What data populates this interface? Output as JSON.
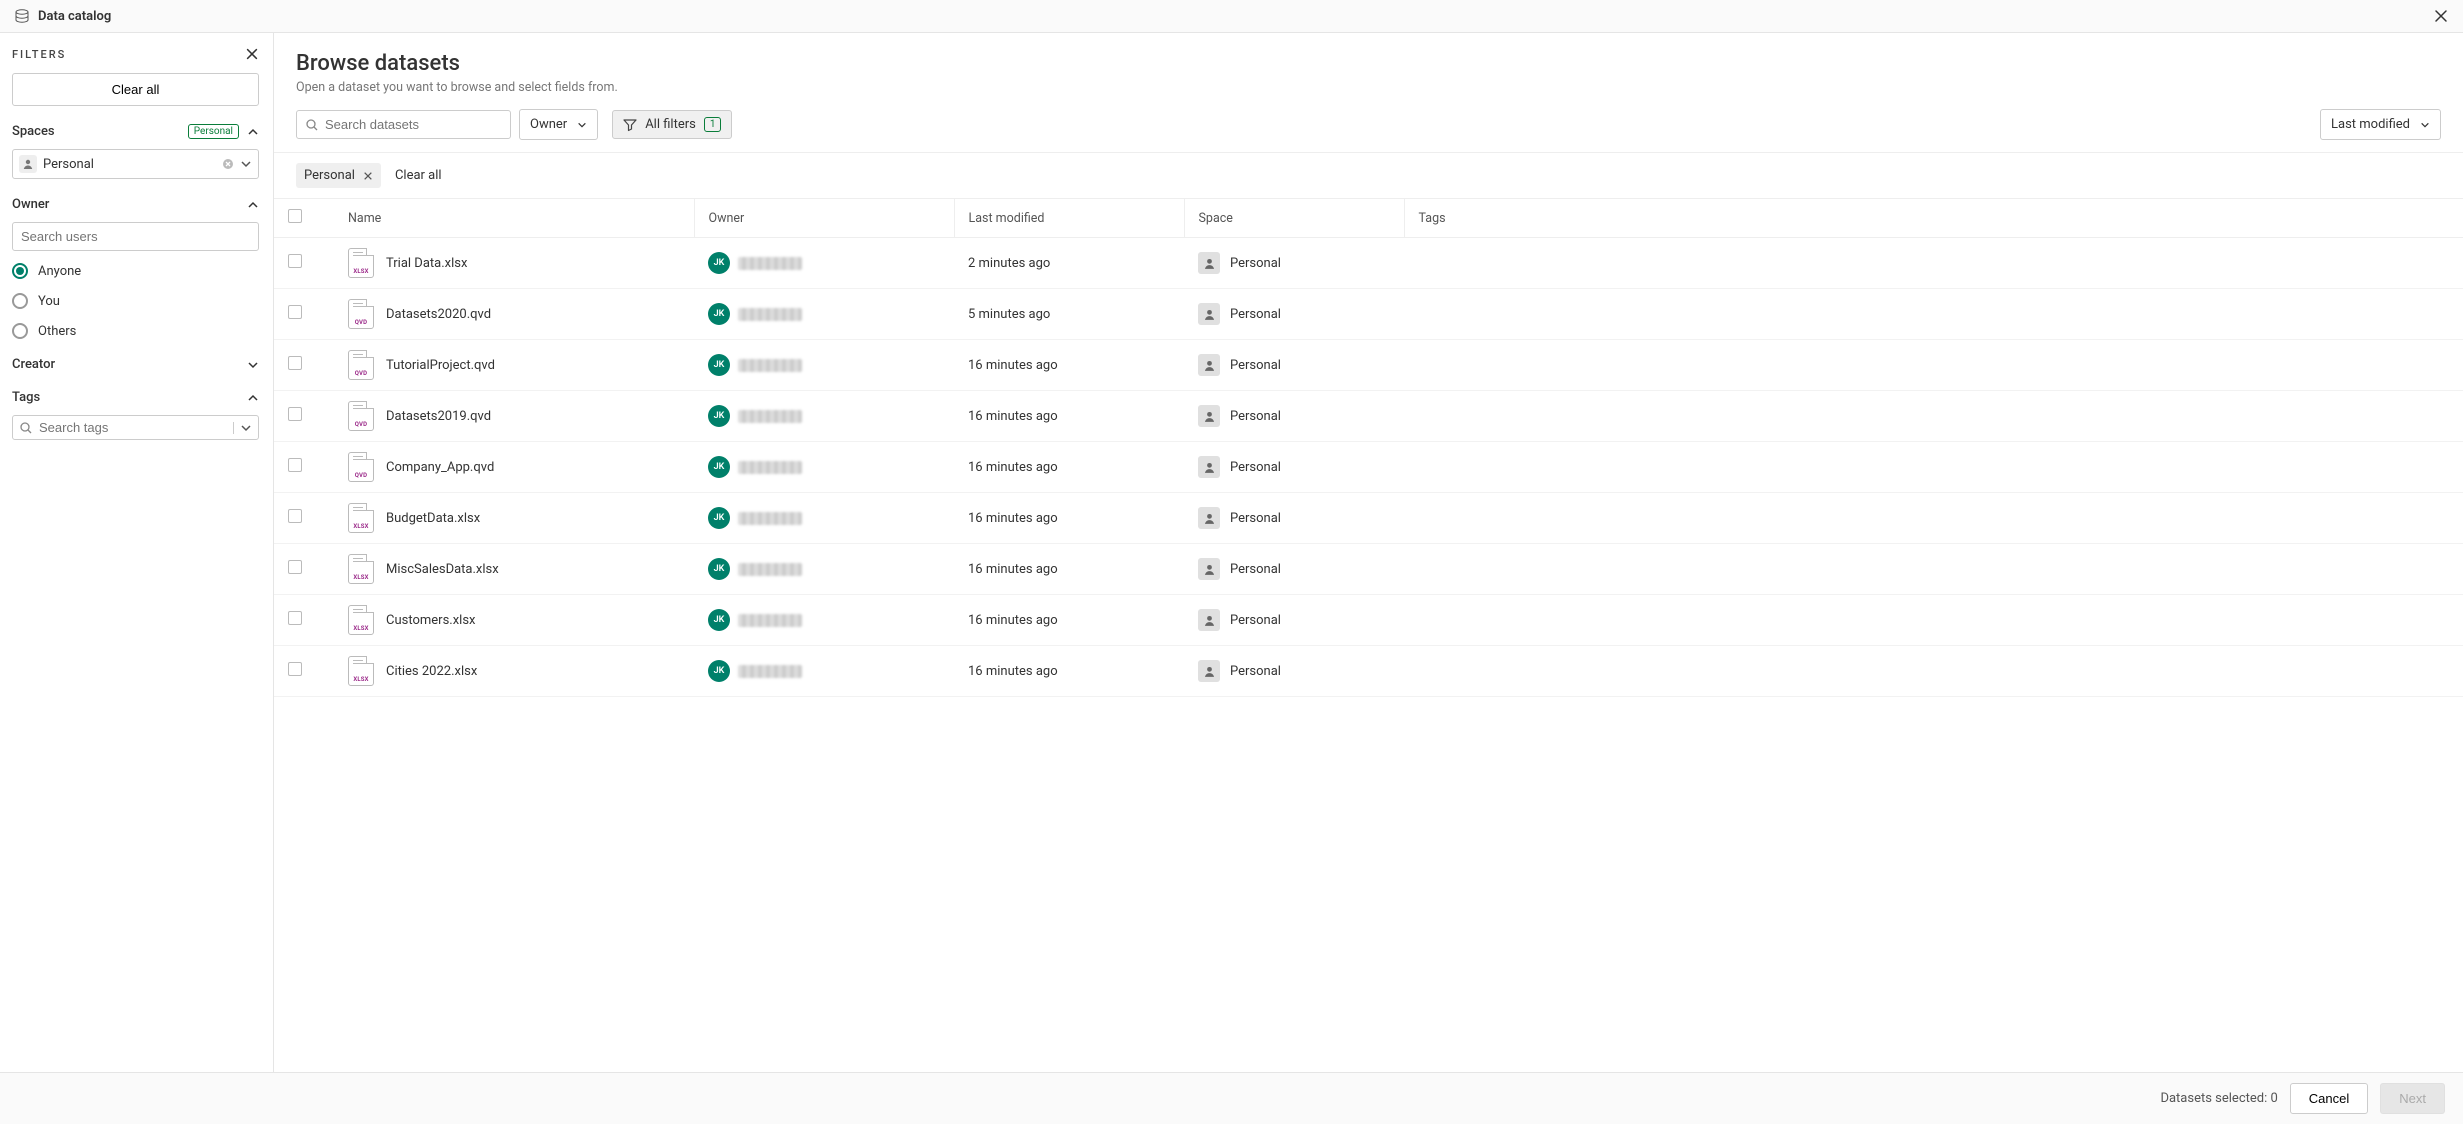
{
  "topbar": {
    "title": "Data catalog"
  },
  "sidebar": {
    "header": "FILTERS",
    "clear_all": "Clear all",
    "spaces": {
      "title": "Spaces",
      "badge": "Personal",
      "selected": "Personal"
    },
    "owner": {
      "title": "Owner",
      "search_placeholder": "Search users",
      "options": {
        "anyone": "Anyone",
        "you": "You",
        "others": "Others"
      }
    },
    "creator": {
      "title": "Creator"
    },
    "tags": {
      "title": "Tags",
      "search_placeholder": "Search tags"
    }
  },
  "main": {
    "title": "Browse datasets",
    "subtitle": "Open a dataset you want to browse and select fields from.",
    "search_placeholder": "Search datasets",
    "owner_dropdown": "Owner",
    "all_filters": "All filters",
    "all_filters_count": "1",
    "sort": "Last modified",
    "chip": "Personal",
    "chips_clear": "Clear all",
    "columns": {
      "name": "Name",
      "owner": "Owner",
      "modified": "Last modified",
      "space": "Space",
      "tags": "Tags"
    },
    "owner_initials": "JK",
    "rows": [
      {
        "name": "Trial Data.xlsx",
        "ext": "XLSX",
        "modified": "2 minutes ago",
        "space": "Personal"
      },
      {
        "name": "Datasets2020.qvd",
        "ext": "QVD",
        "modified": "5 minutes ago",
        "space": "Personal"
      },
      {
        "name": "TutorialProject.qvd",
        "ext": "QVD",
        "modified": "16 minutes ago",
        "space": "Personal"
      },
      {
        "name": "Datasets2019.qvd",
        "ext": "QVD",
        "modified": "16 minutes ago",
        "space": "Personal"
      },
      {
        "name": "Company_App.qvd",
        "ext": "QVD",
        "modified": "16 minutes ago",
        "space": "Personal"
      },
      {
        "name": "BudgetData.xlsx",
        "ext": "XLSX",
        "modified": "16 minutes ago",
        "space": "Personal"
      },
      {
        "name": "MiscSalesData.xlsx",
        "ext": "XLSX",
        "modified": "16 minutes ago",
        "space": "Personal"
      },
      {
        "name": "Customers.xlsx",
        "ext": "XLSX",
        "modified": "16 minutes ago",
        "space": "Personal"
      },
      {
        "name": "Cities 2022.xlsx",
        "ext": "XLSX",
        "modified": "16 minutes ago",
        "space": "Personal"
      }
    ]
  },
  "footer": {
    "selected": "Datasets selected: 0",
    "cancel": "Cancel",
    "next": "Next"
  }
}
